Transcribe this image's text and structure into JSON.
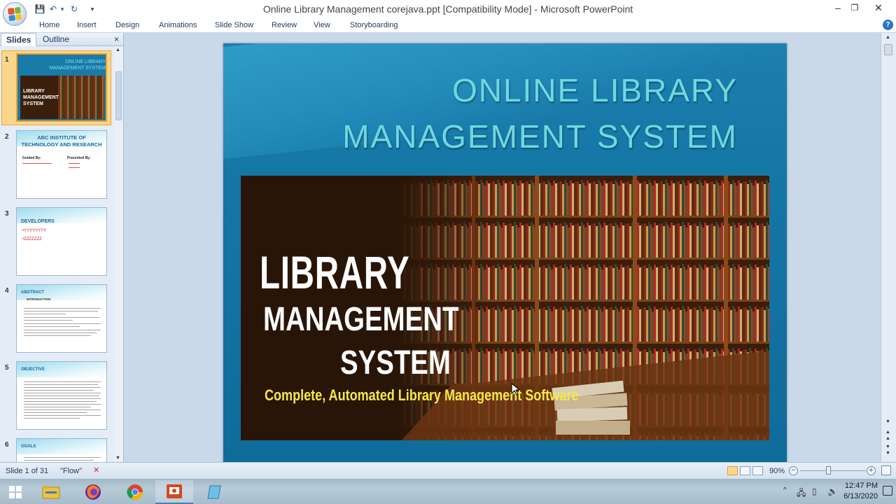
{
  "window": {
    "title": "Online Library Management corejava.ppt [Compatibility Mode] - Microsoft PowerPoint",
    "minimize": "–",
    "restore": "❐",
    "close": "✕"
  },
  "qat": {
    "save": "💾",
    "undo": "↶",
    "undo_dd": "▾",
    "redo": "↻",
    "customize": "▾"
  },
  "ribbon": {
    "tabs": [
      "Home",
      "Insert",
      "Design",
      "Animations",
      "Slide Show",
      "Review",
      "View",
      "Storyboarding"
    ],
    "help": "?"
  },
  "panel": {
    "tabs": [
      "Slides",
      "Outline"
    ],
    "close": "×",
    "slides": [
      {
        "num": "1",
        "title": "ONLINE LIBRARY MANAGEMENT SYSTEM",
        "banner1": "LIBRARY",
        "banner2": "MANAGEMENT",
        "banner3": "SYSTEM"
      },
      {
        "num": "2",
        "title": "ABC INSTITUTE OF TECHNOLOGY AND RESEARCH",
        "left_label": "Guided By:",
        "right_label": "Presented By:"
      },
      {
        "num": "3",
        "title": "DEVELOPERS",
        "items": [
          "•YYYYYYYY",
          "•ZZZZZZZ"
        ]
      },
      {
        "num": "4",
        "title": "ABSTRACT",
        "subtitle": "INTRODUCTION"
      },
      {
        "num": "5",
        "title": "OBJECTIVE"
      },
      {
        "num": "6",
        "title": "GOALS"
      }
    ]
  },
  "slide": {
    "title_line1": "ONLINE LIBRARY",
    "title_line2": "MANAGEMENT SYSTEM",
    "banner_line1": "LIBRARY",
    "banner_line2": "MANAGEMENT",
    "banner_line3": "SYSTEM",
    "banner_subtitle": "Complete, Automated Library Management Software"
  },
  "status": {
    "slide_info": "Slide 1 of 31",
    "theme": "\"Flow\"",
    "zoom": "90%",
    "zoom_out": "−",
    "zoom_in": "+"
  },
  "taskbar": {
    "time": "12:47 PM",
    "date": "6/13/2020",
    "tray_chevron": "^"
  }
}
